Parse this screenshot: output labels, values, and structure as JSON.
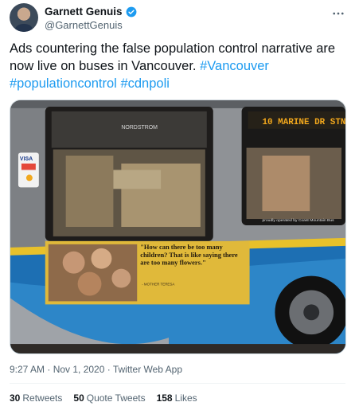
{
  "author": {
    "display_name": "Garnett Genuis",
    "handle": "@GarnettGenuis"
  },
  "tweet": {
    "text_plain": "Ads countering the false population control narrative are now live on buses in Vancouver. ",
    "hashtags": [
      "#Vancouver",
      "#populationcontrol",
      "#cdnpoli"
    ]
  },
  "media": {
    "bus_sign": "10 MARINE DR STN",
    "store_sign": "NORDSTROM",
    "operator_text": "proudly operated by Coast Mountain Bus",
    "ad_quote": "\"How can there be too many children? That is like saying there are too many flowers.\"",
    "ad_attribution": "- MOTHER TERESA",
    "card_label": "VISA"
  },
  "meta": {
    "timestamp": "9:27 AM · Nov 1, 2020 · Twitter Web App"
  },
  "stats": [
    {
      "count": "30",
      "label": "Retweets"
    },
    {
      "count": "50",
      "label": "Quote Tweets"
    },
    {
      "count": "158",
      "label": "Likes"
    }
  ]
}
